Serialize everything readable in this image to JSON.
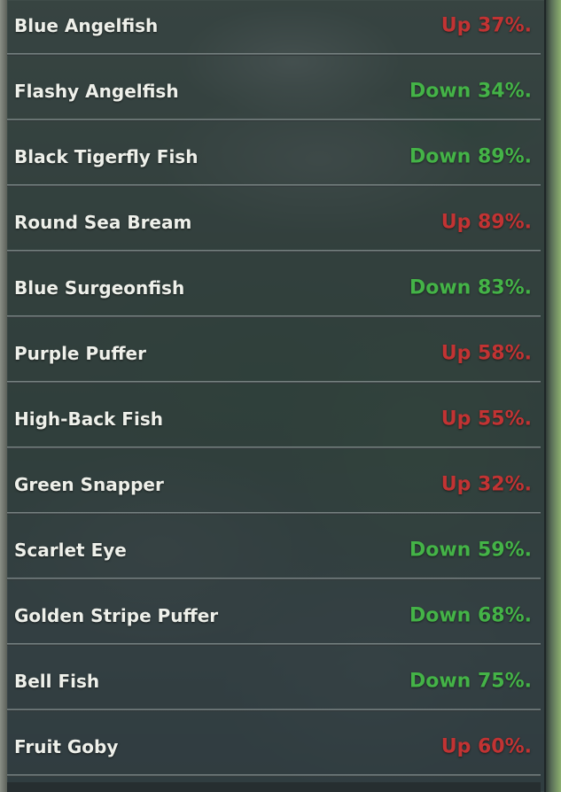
{
  "fish_list": [
    {
      "name": "Blue Angelfish",
      "change": "Up 37%.",
      "direction": "up"
    },
    {
      "name": "Flashy Angelfish",
      "change": "Down 34%.",
      "direction": "down"
    },
    {
      "name": "Black Tigerfly Fish",
      "change": "Down 89%.",
      "direction": "down"
    },
    {
      "name": "Round Sea Bream",
      "change": "Up 89%.",
      "direction": "up"
    },
    {
      "name": "Blue Surgeonfish",
      "change": "Down 83%.",
      "direction": "down"
    },
    {
      "name": "Purple Puffer",
      "change": "Up 58%.",
      "direction": "up"
    },
    {
      "name": "High-Back Fish",
      "change": "Up 55%.",
      "direction": "up"
    },
    {
      "name": "Green Snapper",
      "change": "Up 32%.",
      "direction": "up"
    },
    {
      "name": "Scarlet Eye",
      "change": "Down 59%.",
      "direction": "down"
    },
    {
      "name": "Golden Stripe Puffer",
      "change": "Down 68%.",
      "direction": "down"
    },
    {
      "name": "Bell Fish",
      "change": "Down 75%.",
      "direction": "down"
    },
    {
      "name": "Fruit Goby",
      "change": "Up 60%.",
      "direction": "up"
    }
  ],
  "colors": {
    "up": "#c23333",
    "down": "#44b347"
  }
}
